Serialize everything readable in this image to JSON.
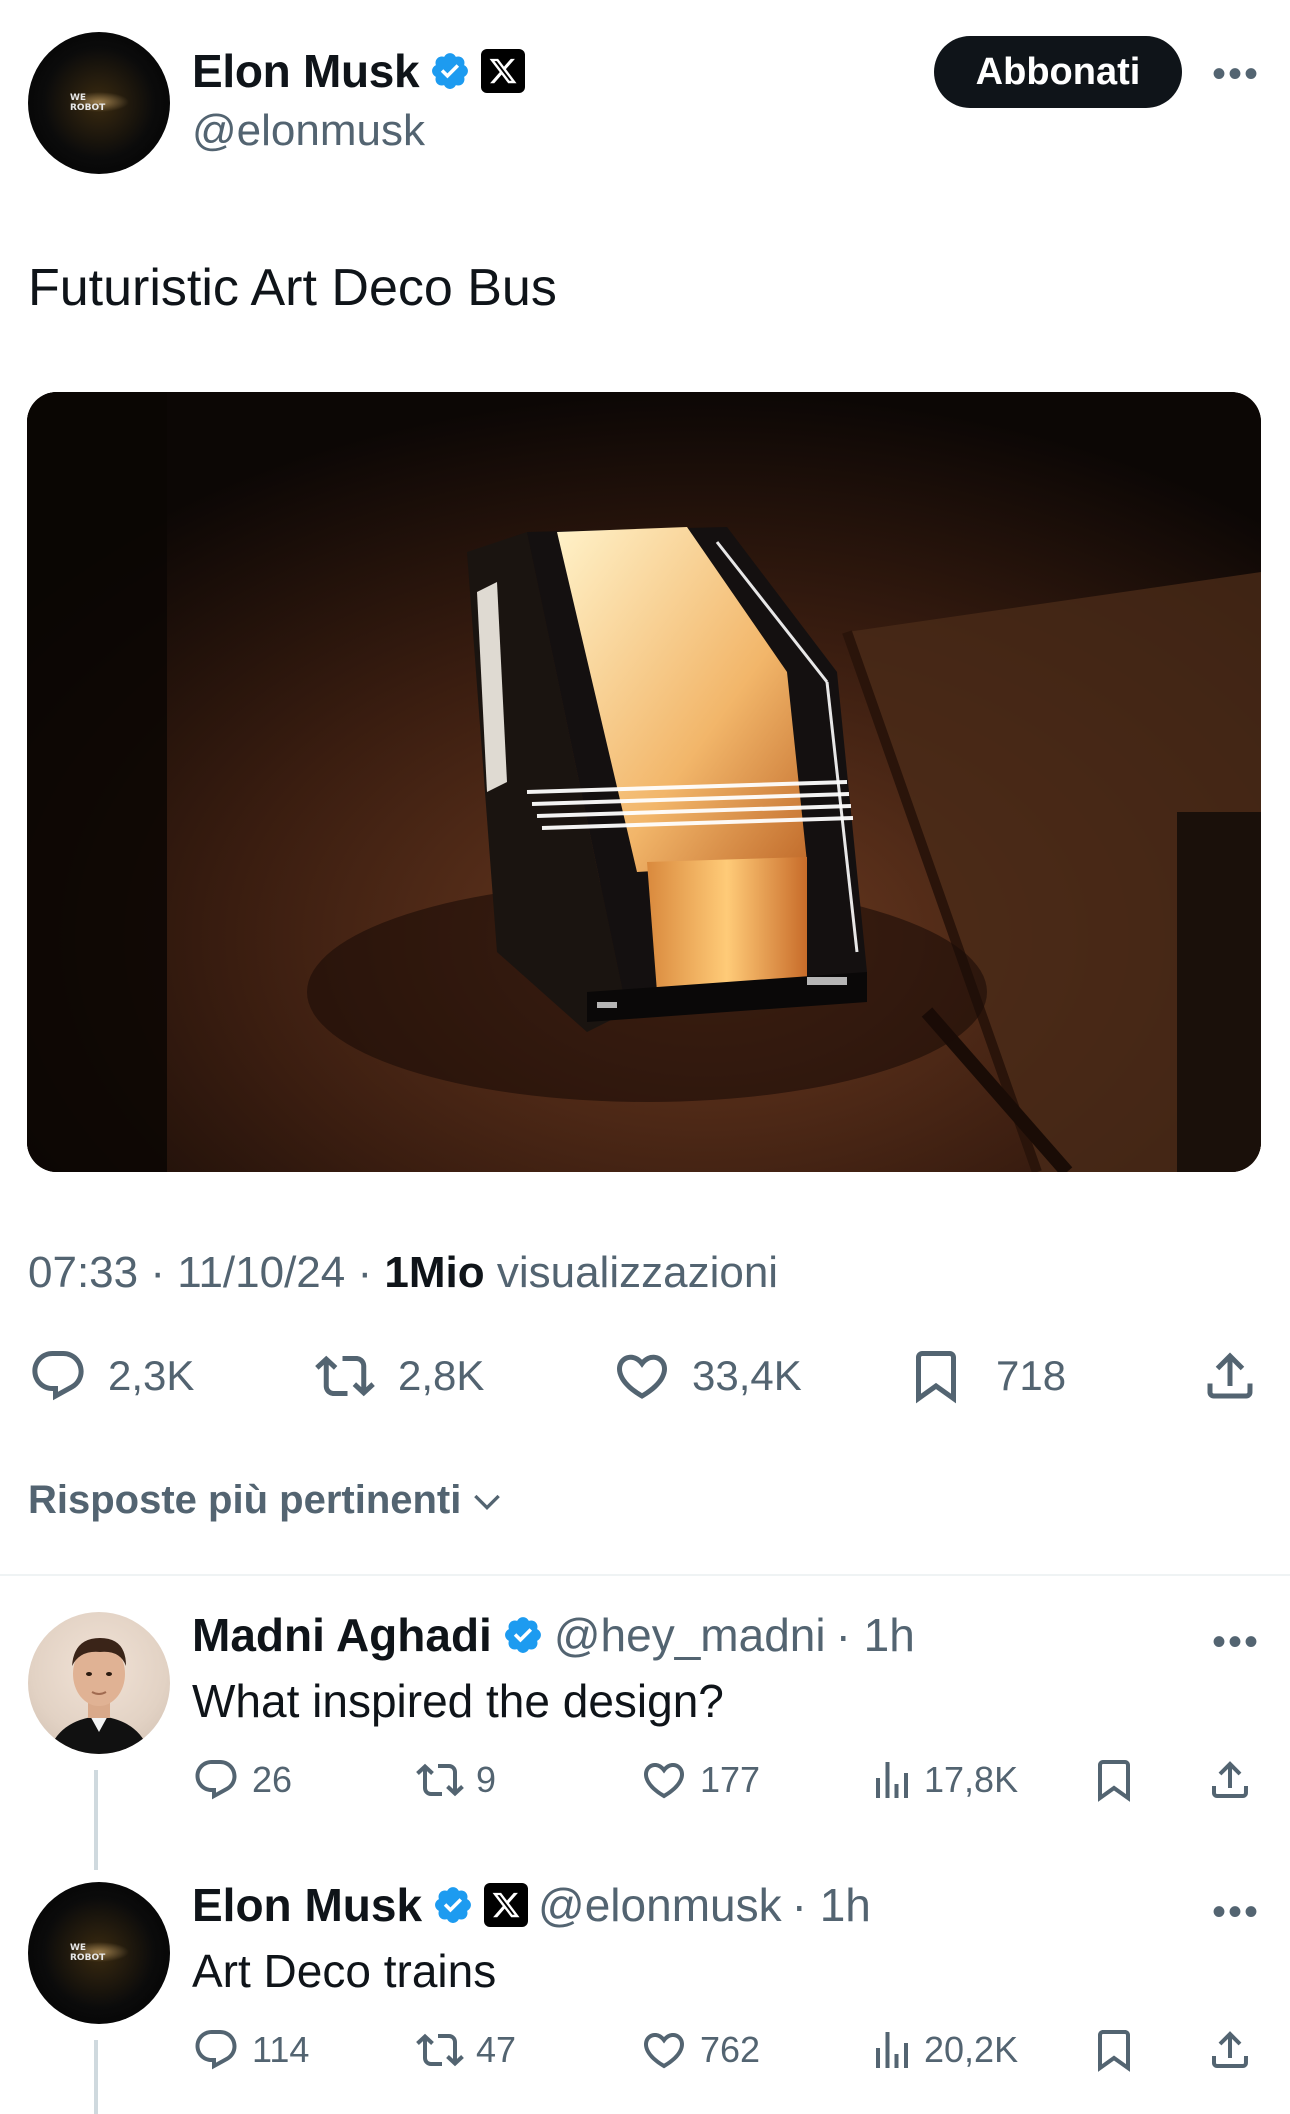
{
  "tweet": {
    "author_name": "Elon Musk",
    "author_handle": "@elonmusk",
    "subscribe_label": "Abbonati",
    "more_label": "•••",
    "text": "Futuristic Art Deco Bus",
    "time": "07:33",
    "date": "11/10/24",
    "views_count": "1Mio",
    "views_label": "visualizzazioni",
    "replies": "2,3K",
    "reposts": "2,8K",
    "likes": "33,4K",
    "bookmarks": "718",
    "avatar_text": "WE ROBOT"
  },
  "replies_section": {
    "title": "Risposte più pertinenti"
  },
  "replies": [
    {
      "name": "Madni Aghadi",
      "handle": "@hey_madni",
      "time": "· 1h",
      "text": "What inspired the design?",
      "replies": "26",
      "reposts": "9",
      "likes": "177",
      "views": "17,8K",
      "more_label": "•••"
    },
    {
      "name": "Elon Musk",
      "handle": "@elonmusk",
      "time": "· 1h",
      "text": "Art Deco trains",
      "replies": "114",
      "reposts": "47",
      "likes": "762",
      "views": "20,2K",
      "more_label": "•••"
    }
  ],
  "colors": {
    "verified": "#1d9bf0",
    "secondary_text": "#536471",
    "primary_text": "#0f1419"
  },
  "icons": [
    "verified-badge-icon",
    "x-logo-icon",
    "reply-icon",
    "repost-icon",
    "like-icon",
    "bookmark-icon",
    "share-icon",
    "views-icon",
    "chevron-down-icon",
    "more-icon"
  ]
}
